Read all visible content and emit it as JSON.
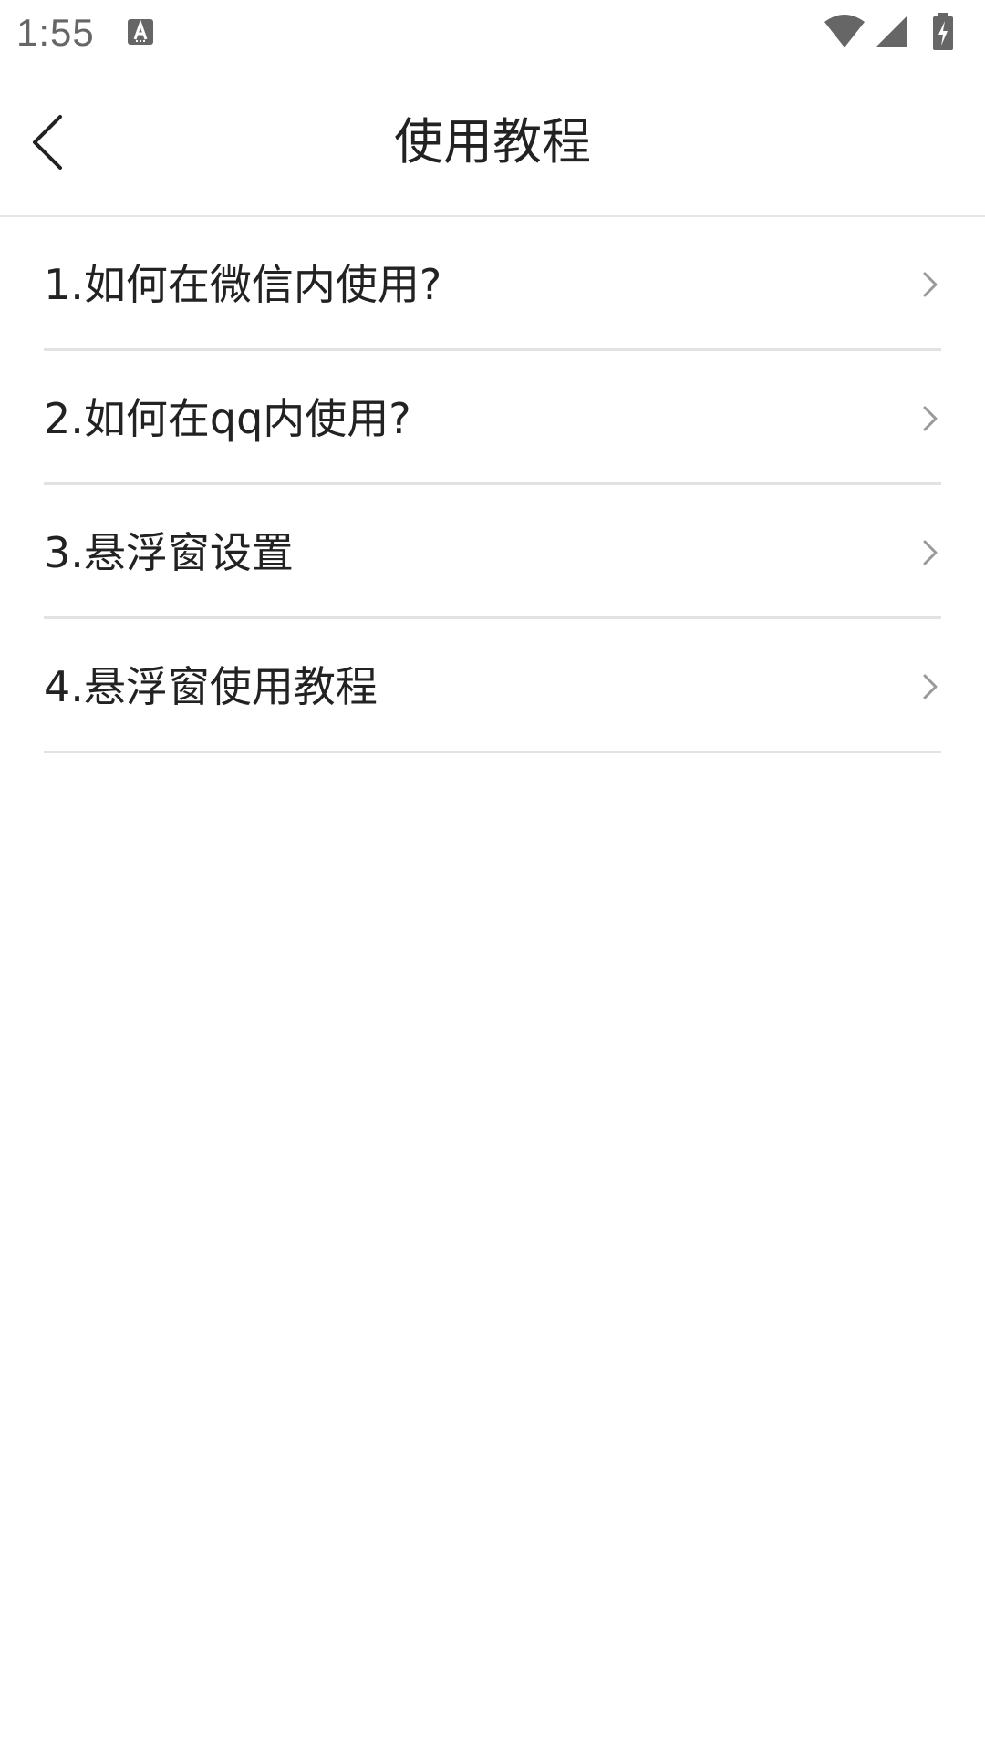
{
  "status_bar": {
    "time": "1:55",
    "notification_icon": "text-a-icon",
    "icons": [
      "wifi-icon",
      "cellular-signal-icon",
      "battery-charging-icon"
    ]
  },
  "header": {
    "back_icon": "chevron-left-icon",
    "title": "使用教程"
  },
  "list": {
    "items": [
      {
        "label": "1.如何在微信内使用?",
        "icon": "chevron-right-icon"
      },
      {
        "label": "2.如何在qq内使用?",
        "icon": "chevron-right-icon"
      },
      {
        "label": "3.悬浮窗设置",
        "icon": "chevron-right-icon"
      },
      {
        "label": "4.悬浮窗使用教程",
        "icon": "chevron-right-icon"
      }
    ]
  },
  "colors": {
    "background": "#ffffff",
    "text": "#222222",
    "divider": "#e2e2e2",
    "chevron": "#9a9a9a",
    "status_icon": "#666666"
  }
}
